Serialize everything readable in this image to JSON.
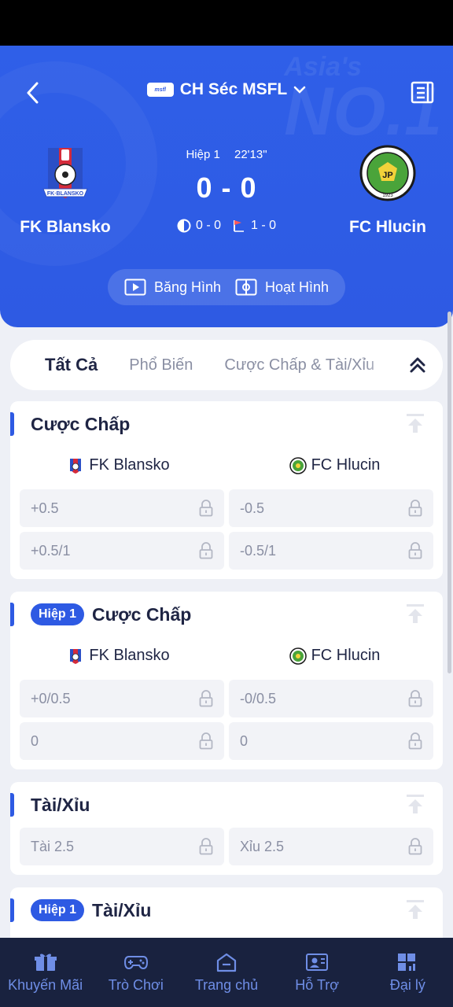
{
  "header": {
    "league_name": "CH Séc MSFL",
    "league_logo_text": "msfl",
    "watermark_top": "Asia's",
    "watermark_main": "NO.1"
  },
  "match": {
    "home_team": "FK Blansko",
    "away_team": "FC Hlucin",
    "home_crest_text": "FK·BLANSKO",
    "away_crest_text": "FOOTBALL CLUB HLUCIN",
    "away_crest_year": "1923",
    "period": "Hiệp 1",
    "clock": "22'13\"",
    "score": "0 - 0",
    "halftime_score": "0 - 0",
    "corners_score": "1 - 0"
  },
  "media": {
    "video_label": "Băng Hình",
    "animation_label": "Hoạt Hình"
  },
  "tabs": [
    {
      "label": "Tất Cả",
      "active": true
    },
    {
      "label": "Phổ Biến",
      "active": false
    },
    {
      "label": "Cược Chấp & Tài/Xỉu",
      "active": false
    }
  ],
  "markets": {
    "handicap": {
      "title": "Cược Chấp",
      "home": "FK Blansko",
      "away": "FC Hlucin",
      "rows": [
        [
          "+0.5",
          "-0.5"
        ],
        [
          "+0.5/1",
          "-0.5/1"
        ]
      ]
    },
    "h1_handicap": {
      "badge": "Hiệp 1",
      "title": "Cược Chấp",
      "home": "FK Blansko",
      "away": "FC Hlucin",
      "rows": [
        [
          "+0/0.5",
          "-0/0.5"
        ],
        [
          "0",
          "0"
        ]
      ]
    },
    "over_under": {
      "title": "Tài/Xỉu",
      "rows": [
        [
          "Tài 2.5",
          "Xỉu 2.5"
        ]
      ]
    },
    "h1_over_under": {
      "badge": "Hiệp 1",
      "title": "Tài/Xỉu"
    }
  },
  "nav": [
    {
      "label": "Khuyến Mãi",
      "icon": "gift-icon"
    },
    {
      "label": "Trò Chơi",
      "icon": "gamepad-icon"
    },
    {
      "label": "Trang chủ",
      "icon": "home-icon"
    },
    {
      "label": "Hỗ Trợ",
      "icon": "support-icon"
    },
    {
      "label": "Đại lý",
      "icon": "agent-icon"
    }
  ],
  "colors": {
    "brand_blue": "#2e5ae3",
    "nav_bg": "#19223f",
    "nav_icon": "#6f8ee6"
  }
}
